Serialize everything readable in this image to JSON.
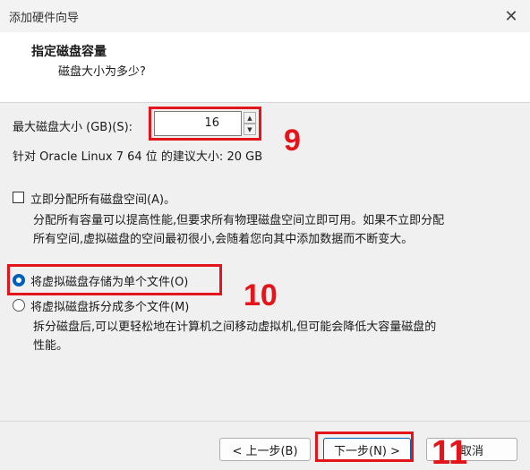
{
  "window": {
    "title": "添加硬件向导",
    "close_glyph": "✕"
  },
  "header": {
    "title": "指定磁盘容量",
    "subtitle": "磁盘大小为多少?"
  },
  "disk_size": {
    "label": "最大磁盘大小 (GB)(S):",
    "value": "16",
    "up_glyph": "▲",
    "down_glyph": "▼",
    "recommended": "针对 Oracle Linux 7 64 位 的建议大小: 20 GB"
  },
  "allocate": {
    "label": "立即分配所有磁盘空间(A)。",
    "checked": false,
    "desc_line1": "分配所有容量可以提高性能,但要求所有物理磁盘空间立即可用。如果不立即分配",
    "desc_line2": "所有空间,虚拟磁盘的空间最初很小,会随着您向其中添加数据而不断变大。"
  },
  "storage": {
    "single_label": "将虚拟磁盘存储为单个文件(O)",
    "single_selected": true,
    "split_label": "将虚拟磁盘拆分成多个文件(M)",
    "split_selected": false,
    "split_desc_line1": "拆分磁盘后,可以更轻松地在计算机之间移动虚拟机,但可能会降低大容量磁盘的",
    "split_desc_line2": "性能。"
  },
  "buttons": {
    "back": "< 上一步(B)",
    "next": "下一步(N) >",
    "cancel": "取消"
  },
  "annotations": {
    "n9": "9",
    "n10": "10",
    "n11": "11",
    "color": "#e3141a"
  }
}
